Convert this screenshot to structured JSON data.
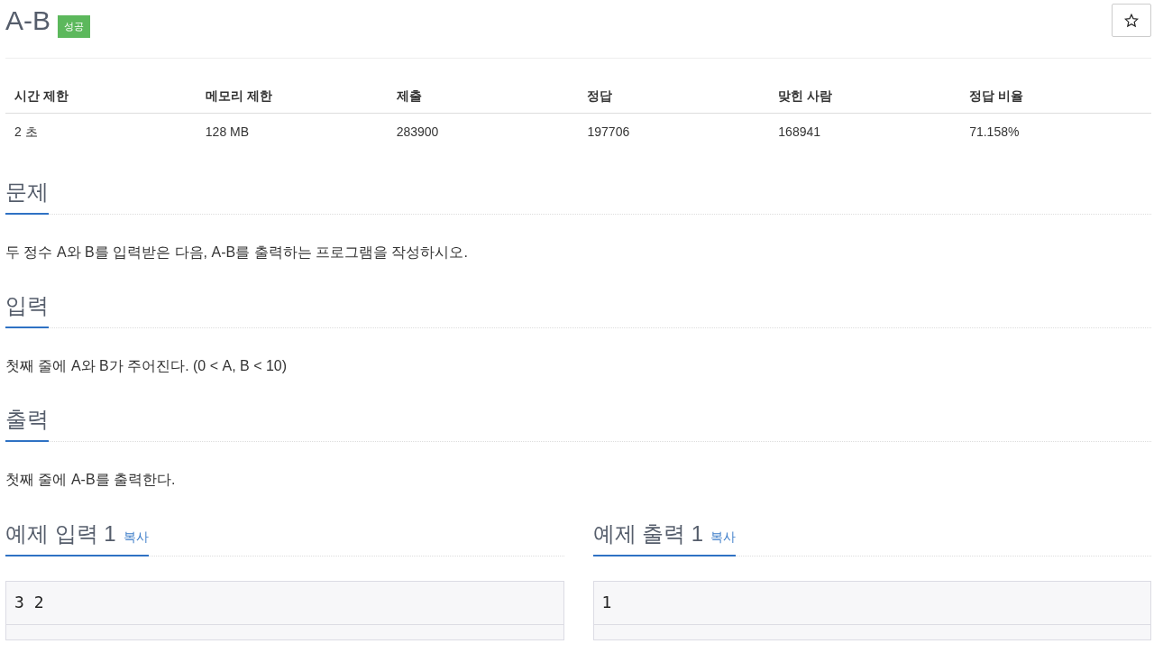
{
  "problem": {
    "title": "A-B",
    "status_badge": "성공",
    "favorite": {
      "starred": false
    }
  },
  "info_table": {
    "columns": [
      "시간 제한",
      "메모리 제한",
      "제출",
      "정답",
      "맞힌 사람",
      "정답 비율"
    ],
    "rows": [
      [
        "2 초",
        "128 MB",
        "283900",
        "197706",
        "168941",
        "71.158%"
      ]
    ]
  },
  "sections": [
    {
      "heading": "문제",
      "text": "두 정수 A와 B를 입력받은 다음, A-B를 출력하는 프로그램을 작성하시오."
    },
    {
      "heading": "입력",
      "text": "첫째 줄에 A와 B가 주어진다. (0 < A, B < 10)"
    },
    {
      "heading": "출력",
      "text": "첫째 줄에 A-B를 출력한다."
    }
  ],
  "samples": [
    {
      "heading": "예제 입력 1",
      "copy_link": "복사",
      "content": "3 2"
    },
    {
      "heading": "예제 출력 1",
      "copy_link": "복사",
      "content": "1"
    }
  ]
}
